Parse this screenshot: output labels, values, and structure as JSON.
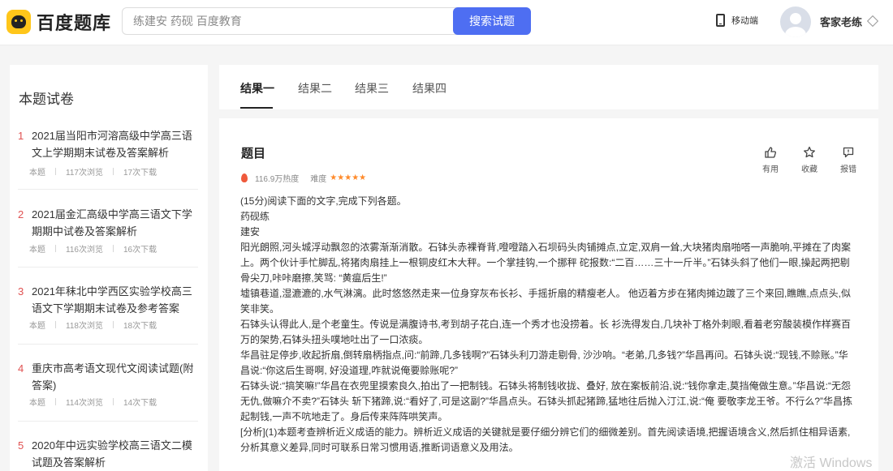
{
  "header": {
    "logo_text": "百度题库",
    "search_placeholder": "练建安 药砚 百度教育",
    "search_button": "搜索试题",
    "mobile_label": "移动端",
    "username": "客家老练"
  },
  "sidebar": {
    "title": "本题试卷",
    "papers": [
      {
        "num": "1",
        "title": "2021届当阳市河溶高级中学高三语文上学期期末试卷及答案解析",
        "label": "本题",
        "views": "117次浏览",
        "downloads": "17次下载"
      },
      {
        "num": "2",
        "title": "2021届金汇高级中学高三语文下学期期中试卷及答案解析",
        "label": "本题",
        "views": "116次浏览",
        "downloads": "16次下载"
      },
      {
        "num": "3",
        "title": "2021年秣北中学西区实验学校高三语文下学期期末试卷及参考答案",
        "label": "本题",
        "views": "118次浏览",
        "downloads": "18次下载"
      },
      {
        "num": "4",
        "title": "重庆市高考语文现代文阅读试题(附答案)",
        "label": "本题",
        "views": "114次浏览",
        "downloads": "14次下载"
      },
      {
        "num": "5",
        "title": "2020年中远实验学校高三语文二模试题及答案解析",
        "label": "",
        "views": "",
        "downloads": ""
      }
    ]
  },
  "tabs": [
    "结果一",
    "结果二",
    "结果三",
    "结果四"
  ],
  "question": {
    "heading": "题目",
    "heat": "116.9万热度",
    "difficulty_label": "难度",
    "stars": "★★★★★",
    "actions": {
      "useful": "有用",
      "favorite": "收藏",
      "report": "报错"
    },
    "paragraphs": [
      "(15分)阅读下面的文字,完成下列各题。",
      "药砚练",
      "建安",
      "阳光朗照,河头城浮动飘忽的浓雾渐渐消散。石钵头赤裸脊背,噔噔踏入石坝码头肉铺摊点,立定,双肩一耸,大块猪肉扇啪嗒一声脆响,平摊在了肉案上。两个伙计手忙脚乱,将猪肉扇挂上一根铜皮红木大秤。一个掌挂钩,一个挪秤 砣报数:“二百……三十一斤半。”石钵头斜了他们一眼,操起两把剔骨尖刀,咔咔磨擦,笑骂: “黄瘟后生!”",
      "墟镇巷道,湿漉漉的,水气淋漓。此时悠悠然走来一位身穿灰布长衫、手摇折扇的精瘦老人。 他迈着方步在猪肉摊边踱了三个来回,瞧瞧,点点头,似笑非笑。",
      "石钵头认得此人,是个老童生。传说是满腹诗书,考到胡子花白,连一个秀才也没捞着。长 衫洗得发白,几块补丁格外刺眼,看着老穷酸装模作样赛百万的架势,石钵头扭头噗地吐出了一口浓痰。",
      "华昌驻足停步,收起折扇,倒转扇柄指点,问:“前蹄,几多钱啊?”石钵头利刀游走剔骨, 沙沙响。“老弟,几多钱?”华昌再问。石钵头说:“现钱,不赊账。”华昌说:“你这后生哥啊, 好没道理,咋就说俺要赊账呢?”",
      "石钵头说:“搞笑嘛!”华昌在衣兜里摸索良久,拍出了一把制钱。石钵头将制钱收拢、叠好, 放在案板前沿,说:“钱你拿走,莫挡俺做生意。”华昌说:“无怨无仇,做嘛介不卖?”石钵头 斩下猪蹄,说:“看好了,可是这副?”华昌点头。石钵头抓起猪蹄,猛地往后抛入汀江,说:“俺 要敬李龙王爷。不行么?”华昌拣起制钱,一声不吭地走了。身后传来阵阵哄笑声。",
      "[分析](1)本题考查辨析近义成语的能力。辨析近义成语的关键就是要仔细分辨它们的细微差别。首先阅读语境,把握语境含义,然后抓住相异语素,分析其意义差异,同时可联系日常习惯用语,推断词语意义及用法。"
    ]
  },
  "watermark": "激活 Windows"
}
